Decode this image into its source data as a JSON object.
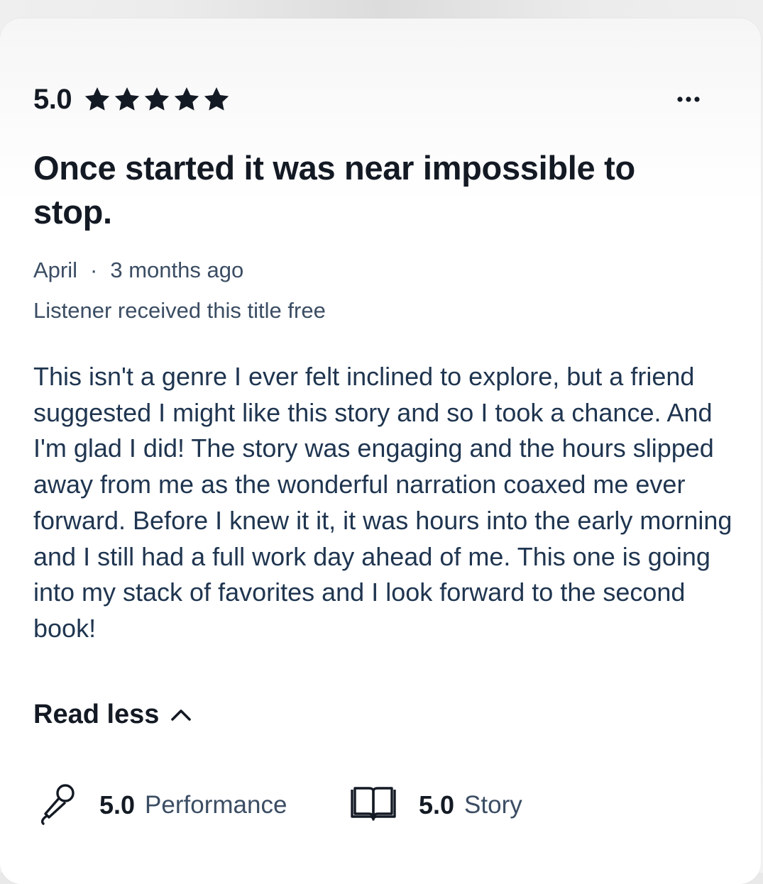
{
  "review": {
    "rating_value": "5.0",
    "star_count": 5,
    "more_label": "More options",
    "title": "Once started it was near impossible to stop.",
    "author": "April",
    "separator": "·",
    "time_ago": "3 months ago",
    "free_note": "Listener received this title free",
    "body": "This isn't a genre I ever felt inclined to explore, but a friend suggested I might like this story and so I took a chance.  And I'm glad I did!  The story was engaging and the hours slipped away from me as the wonderful narration coaxed me ever forward.  Before I knew it it, it was hours into the early morning and I still had a full work day ahead of me.  This one is going into my stack of favorites and I look forward to the second book!",
    "read_less_label": "Read less"
  },
  "scores": {
    "performance": {
      "value": "5.0",
      "label": "Performance",
      "icon": "microphone-icon"
    },
    "story": {
      "value": "5.0",
      "label": "Story",
      "icon": "book-icon"
    }
  },
  "colors": {
    "heading": "#141a24",
    "body_text": "#1f3550",
    "muted_text": "#3b4d63",
    "card_background": "#ffffff"
  }
}
